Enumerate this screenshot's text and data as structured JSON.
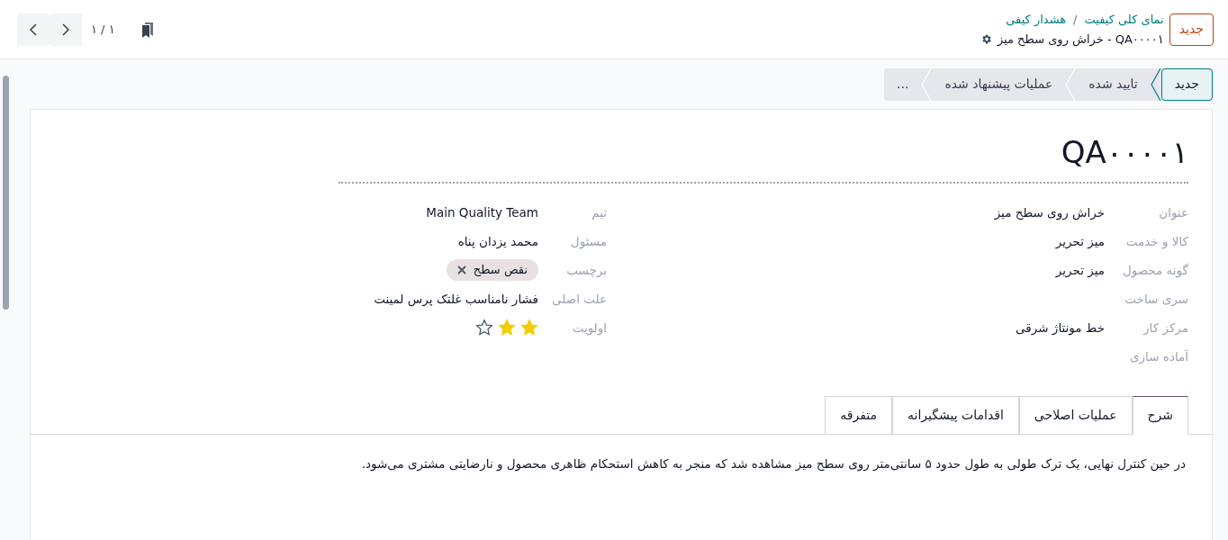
{
  "header": {
    "new_button": "جدید",
    "breadcrumb": [
      "نمای کلی کیفیت",
      "هشدار کیفی"
    ],
    "breadcrumb_separator": "/",
    "record_title": "QA۰۰۰۰۱ - خراش روی سطح میز",
    "pager": "۱ / ۱"
  },
  "stages": [
    {
      "label": "جدید",
      "selected": true
    },
    {
      "label": "تایید شده",
      "selected": false
    },
    {
      "label": "عملیات پیشنهاد شده",
      "selected": false
    },
    {
      "label": "...",
      "selected": false
    }
  ],
  "form": {
    "title": "QA۰۰۰۰۱",
    "right_fields": [
      {
        "label": "عنوان",
        "value": "خراش روی سطح میز"
      },
      {
        "label": "کالا و خدمت",
        "value": "میز تحریر"
      },
      {
        "label": "گونه محصول",
        "value": "میز تحریر"
      },
      {
        "label": "سری ساخت"
      },
      {
        "label": "مرکز کار",
        "value": "خط مونتاژ شرقی"
      },
      {
        "label": "آماده سازی"
      }
    ],
    "left_fields": [
      {
        "kind": "text",
        "label": "تیم",
        "value": "Main Quality Team"
      },
      {
        "kind": "text",
        "label": "مسئول",
        "value": "محمد یزدان پناه"
      },
      {
        "kind": "tags",
        "label": "برچسب",
        "tags": [
          "نقص سطح"
        ]
      },
      {
        "kind": "text",
        "label": "علت اصلی",
        "value": "فشار نامناسب غلتک پرس لمینت"
      },
      {
        "kind": "priority",
        "label": "اولویت",
        "stars": 2
      }
    ]
  },
  "tabs": [
    {
      "label": "شرح",
      "selected": true
    },
    {
      "label": "عملیات اصلاحی",
      "selected": false
    },
    {
      "label": "اقدامات پیشگیرانه",
      "selected": false
    },
    {
      "label": "متفرقه",
      "selected": false
    }
  ],
  "description": "در حین کنترل نهایی، یک ترک طولی به طول حدود ۵ سانتی‌متر روی سطح میز مشاهده شد که منجر به کاهش استحکام ظاهری محصول و نارضایتی مشتری می‌شود."
}
